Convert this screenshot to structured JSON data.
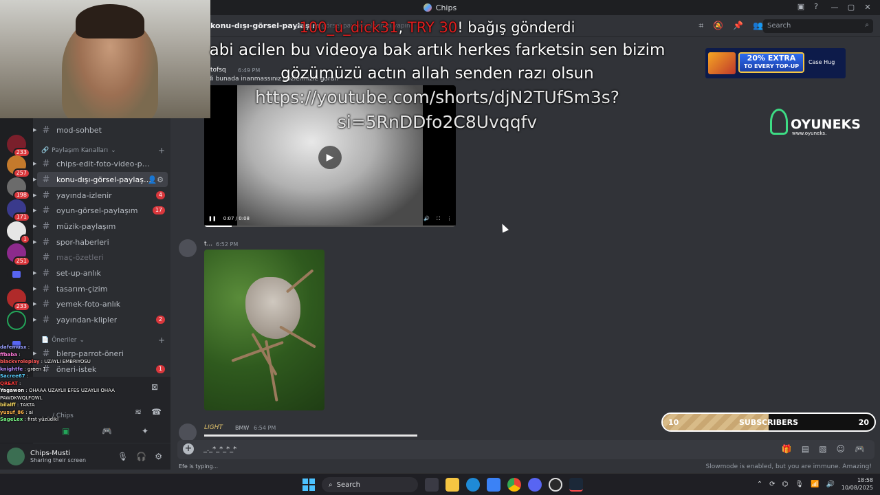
{
  "window": {
    "title": "Chips"
  },
  "header": {
    "channel": "konu-dışı-görsel-paylaşım",
    "topic": "yayında görsel paylaşımlarınızı yapın",
    "search_placeholder": "Search"
  },
  "servers": [
    {
      "badge": "233"
    },
    {
      "badge": "257"
    },
    {
      "badge": "198"
    },
    {
      "badge": "171"
    },
    {
      "badge": "1"
    },
    {
      "badge": "251"
    },
    {
      "badge": ""
    },
    {
      "badge": "233"
    },
    {
      "badge": ""
    },
    {
      "badge": ""
    }
  ],
  "sidebar": {
    "top_channel": "mod-sohbet",
    "category1": "Paylaşım Kanalları",
    "channels": [
      {
        "label": "chips-edit-foto-video-paylaşım",
        "count": ""
      },
      {
        "label": "konu-dışı-görsel-paylaşım",
        "count": ""
      },
      {
        "label": "yayında-izlenir",
        "count": "4"
      },
      {
        "label": "oyun-görsel-paylaşım",
        "count": "17"
      },
      {
        "label": "müzik-paylaşım",
        "count": ""
      },
      {
        "label": "spor-haberleri",
        "count": ""
      },
      {
        "label": "maç-özetleri",
        "count": ""
      },
      {
        "label": "set-up-anlık",
        "count": ""
      },
      {
        "label": "tasarım-çizim",
        "count": ""
      },
      {
        "label": "yemek-foto-anlık",
        "count": ""
      },
      {
        "label": "yayından-klipler",
        "count": "2"
      }
    ],
    "category2": "Öneriler",
    "channels2": [
      {
        "label": "blerp-parrot-öneri",
        "count": ""
      },
      {
        "label": "öneri-istek",
        "count": "1"
      }
    ]
  },
  "voice": {
    "channel": "/ Chips"
  },
  "user": {
    "name": "Chips-Musti",
    "status": "Sharing their screen"
  },
  "messages": [
    {
      "author": "tofsq",
      "time": "6:49 PM",
      "text": "adi bunada inanmassınız gözlerinizle görün"
    },
    {
      "author": "t...",
      "time": "6:52 PM"
    },
    {
      "author": "LIGHT",
      "tag": "BMW",
      "time": "6:54 PM"
    }
  ],
  "video": {
    "time": "0:07 / 0:08"
  },
  "composer": {
    "value": "_._*_*_*_*"
  },
  "typing": "Efe is typing...",
  "slowmode": "Slowmode is enabled, but you are immune. Amazing!",
  "donation": {
    "user": "100_u_dick31",
    "amount": "TRY 30",
    "action": "! bağış gönderdi",
    "message": "abi acilen bu videoya bak artık herkes farketsin sen bizim gözümüzü actın allah senden razı olsun",
    "link1": "https://youtube.com/shorts/djN2TUfSm3s?",
    "link2": "si=5RnDDfo2C8Uvqqfv"
  },
  "ad": {
    "line1": "20% EXTRA",
    "line2": "TO EVERY TOP-UP",
    "brand": "Case Hug"
  },
  "sponsor": {
    "name": "OYUNEKS",
    "url": "www.oyuneks."
  },
  "subscribers": {
    "label": "SUBSCRIBERS",
    "current": "10",
    "goal": "20",
    "progress": 0.5
  },
  "stream_chat": [
    {
      "user": "dafemusx",
      "msg": ":"
    },
    {
      "user": "ffbaba",
      "msg": ":"
    },
    {
      "user": "blackvroleplay",
      "msg": ": UZAYLI EMBRIYOSU"
    },
    {
      "user": "knightfe",
      "msg": ": green 1"
    },
    {
      "user": "Sacree67",
      "msg": ":"
    },
    {
      "user": "QREAT",
      "msg": ":"
    },
    {
      "user": "Yagawon",
      "msg": ": OHAAA UZAYLII EFES UZAYLII OHAA PAWDKWQLFQWL"
    },
    {
      "user": "bilalff",
      "msg": ": TAKTA"
    },
    {
      "user": "yusuf_86",
      "msg": ": ai"
    },
    {
      "user": "SageLex",
      "msg": ": first yüzüdikl"
    }
  ],
  "taskbar": {
    "search": "Search",
    "time": "18:58",
    "date": "10/08/2025"
  },
  "colors": {
    "accent": "#5865f2",
    "danger": "#da373c",
    "bg": "#313338",
    "sidebar": "#2b2d31",
    "rail": "#1e1f22"
  }
}
